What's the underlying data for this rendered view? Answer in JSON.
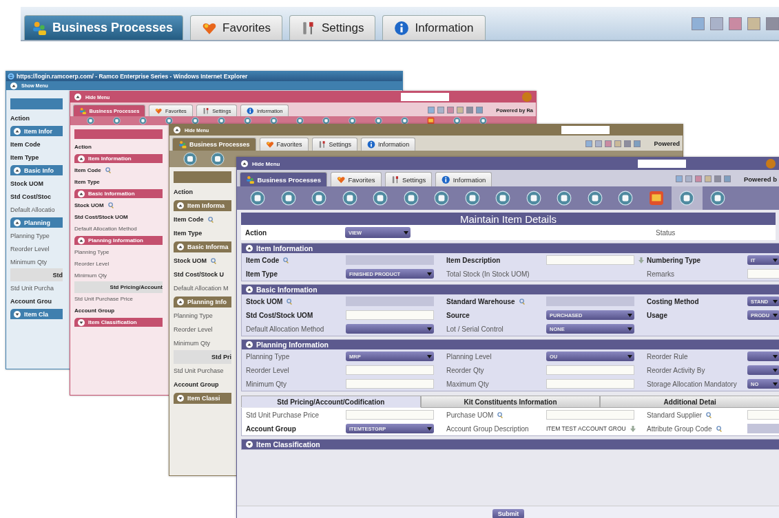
{
  "top_bar": {
    "tabs": [
      {
        "label": "Business Processes",
        "kind": "people",
        "selected": true
      },
      {
        "label": "Favorites",
        "kind": "heart",
        "selected": false
      },
      {
        "label": "Settings",
        "kind": "tools",
        "selected": false
      },
      {
        "label": "Information",
        "kind": "info",
        "selected": false
      }
    ],
    "swatches": [
      {
        "color": "#8fb0d6"
      },
      {
        "color": "#a9b2c9"
      },
      {
        "color": "#c98aa2"
      },
      {
        "color": "#c9b998"
      },
      {
        "color": "#8e8e9e"
      }
    ]
  },
  "windows": [
    {
      "color": "#3f7fae",
      "title": "https://login.ramcoerp.com/ - Ramco Enterprise Series - Windows Internet Explorer",
      "menu_toggle": "Show Menu",
      "strip": [
        {
          "kind": "band"
        },
        {
          "kind": "field",
          "text": "Action",
          "emphasis": true,
          "lookup": false
        },
        {
          "kind": "section",
          "text": "Item Infor",
          "expanded": true
        },
        {
          "kind": "field",
          "text": "Item Code",
          "emphasis": true,
          "lookup": false
        },
        {
          "kind": "field",
          "text": "Item Type",
          "emphasis": true,
          "lookup": false
        },
        {
          "kind": "section",
          "text": "Basic Info",
          "expanded": true
        },
        {
          "kind": "field",
          "text": "Stock UOM",
          "emphasis": true,
          "lookup": false
        },
        {
          "kind": "field",
          "text": "Std Cost/Stoc",
          "emphasis": true,
          "lookup": false
        },
        {
          "kind": "field",
          "text": "Default Allocatio",
          "emphasis": false,
          "lookup": false
        },
        {
          "kind": "section",
          "text": "Planning",
          "expanded": true
        },
        {
          "kind": "field",
          "text": "Planning Type",
          "emphasis": false,
          "lookup": false
        },
        {
          "kind": "field",
          "text": "Reorder Level",
          "emphasis": false,
          "lookup": false
        },
        {
          "kind": "field",
          "text": "Minimum Qty",
          "emphasis": false,
          "lookup": false
        },
        {
          "kind": "tab",
          "text": "Std"
        },
        {
          "kind": "field",
          "text": "Std Unit Purcha",
          "emphasis": false,
          "lookup": false
        },
        {
          "kind": "field",
          "text": "Account Grou",
          "emphasis": true,
          "lookup": false
        },
        {
          "kind": "section",
          "text": "Item Cla",
          "expanded": false
        }
      ]
    },
    {
      "color": "#c4506e",
      "menu_toggle": "Hide Menu",
      "search_field": true,
      "orb": true,
      "tabs": [
        {
          "label": "Business Processes",
          "kind": "people",
          "selected": true
        },
        {
          "label": "Favorites",
          "kind": "heart",
          "selected": false
        },
        {
          "label": "Settings",
          "kind": "tools",
          "selected": false
        },
        {
          "label": "Information",
          "kind": "info",
          "selected": false
        }
      ],
      "swatches": [
        {
          "color": "#8fb0d6"
        },
        {
          "color": "#a9b2c9"
        },
        {
          "color": "#c98aa2"
        },
        {
          "color": "#c9b998"
        },
        {
          "color": "#8e8e9e"
        },
        {
          "color": "#7f9fbf"
        }
      ],
      "powered": "Powered by Ra",
      "toolbar": [
        {
          "kind": "round",
          "selected": false
        },
        {
          "kind": "round",
          "selected": false
        },
        {
          "kind": "round",
          "selected": false
        },
        {
          "kind": "round",
          "selected": false
        },
        {
          "kind": "round",
          "selected": false
        },
        {
          "kind": "round",
          "selected": false
        },
        {
          "kind": "round",
          "selected": false
        },
        {
          "kind": "round",
          "selected": false
        },
        {
          "kind": "round",
          "selected": false
        },
        {
          "kind": "round",
          "selected": false
        },
        {
          "kind": "round",
          "selected": false
        },
        {
          "kind": "round",
          "selected": false
        },
        {
          "kind": "round",
          "selected": false
        },
        {
          "kind": "square",
          "selected": false
        },
        {
          "kind": "round",
          "selected": false
        },
        {
          "kind": "round",
          "selected": false
        }
      ],
      "strip": [
        {
          "kind": "band"
        },
        {
          "kind": "field",
          "text": "Action",
          "emphasis": true,
          "lookup": false
        },
        {
          "kind": "section",
          "text": "Item Information",
          "expanded": true
        },
        {
          "kind": "field",
          "text": "Item Code",
          "emphasis": true,
          "lookup": true
        },
        {
          "kind": "field",
          "text": "Item Type",
          "emphasis": true,
          "lookup": false
        },
        {
          "kind": "section",
          "text": "Basic Information",
          "expanded": true
        },
        {
          "kind": "field",
          "text": "Stock UOM",
          "emphasis": true,
          "lookup": true
        },
        {
          "kind": "field",
          "text": "Std Cost/Stock UOM",
          "emphasis": true,
          "lookup": false
        },
        {
          "kind": "field",
          "text": "Default Allocation Method",
          "emphasis": false,
          "lookup": false
        },
        {
          "kind": "section",
          "text": "Planning Information",
          "expanded": true
        },
        {
          "kind": "field",
          "text": "Planning Type",
          "emphasis": false,
          "lookup": false
        },
        {
          "kind": "field",
          "text": "Reorder Level",
          "emphasis": false,
          "lookup": false
        },
        {
          "kind": "field",
          "text": "Minimum Qty",
          "emphasis": false,
          "lookup": false
        },
        {
          "kind": "tab",
          "text": "Std Pricing/Account"
        },
        {
          "kind": "field",
          "text": "Std Unit Purchase Price",
          "emphasis": false,
          "lookup": false
        },
        {
          "kind": "field",
          "text": "Account Group",
          "emphasis": true,
          "lookup": false
        },
        {
          "kind": "section",
          "text": "Item Classification",
          "expanded": false
        }
      ]
    },
    {
      "color": "#857552",
      "menu_toggle": "Hide Menu",
      "search_field": true,
      "orb": false,
      "tabs": [
        {
          "label": "Business Processes",
          "kind": "people",
          "selected": true
        },
        {
          "label": "Favorites",
          "kind": "heart",
          "selected": false
        },
        {
          "label": "Settings",
          "kind": "tools",
          "selected": false
        },
        {
          "label": "Information",
          "kind": "info",
          "selected": false
        }
      ],
      "swatches": [
        {
          "color": "#8fb0d6"
        },
        {
          "color": "#a9b2c9"
        },
        {
          "color": "#c98aa2"
        },
        {
          "color": "#c9b998"
        },
        {
          "color": "#8e8e9e"
        },
        {
          "color": "#7f9fbf"
        }
      ],
      "powered": "Powered",
      "toolbar": [
        {
          "kind": "round",
          "selected": false
        },
        {
          "kind": "round",
          "selected": false
        }
      ],
      "strip": [
        {
          "kind": "band"
        },
        {
          "kind": "field",
          "text": "Action",
          "emphasis": true,
          "lookup": false
        },
        {
          "kind": "section",
          "text": "Item Informa",
          "expanded": true
        },
        {
          "kind": "field",
          "text": "Item Code",
          "emphasis": true,
          "lookup": true
        },
        {
          "kind": "field",
          "text": "Item Type",
          "emphasis": true,
          "lookup": false
        },
        {
          "kind": "section",
          "text": "Basic Informa",
          "expanded": true
        },
        {
          "kind": "field",
          "text": "Stock UOM",
          "emphasis": true,
          "lookup": true
        },
        {
          "kind": "field",
          "text": "Std Cost/Stock U",
          "emphasis": true,
          "lookup": false
        },
        {
          "kind": "field",
          "text": "Default Allocation M",
          "emphasis": false,
          "lookup": false
        },
        {
          "kind": "section",
          "text": "Planning Info",
          "expanded": true
        },
        {
          "kind": "field",
          "text": "Planning Type",
          "emphasis": false,
          "lookup": false
        },
        {
          "kind": "field",
          "text": "Reorder Level",
          "emphasis": false,
          "lookup": false
        },
        {
          "kind": "field",
          "text": "Minimum Qty",
          "emphasis": false,
          "lookup": false
        },
        {
          "kind": "tab",
          "text": "Std Pri"
        },
        {
          "kind": "field",
          "text": "Std Unit Purchase",
          "emphasis": false,
          "lookup": false
        },
        {
          "kind": "field",
          "text": "Account Group",
          "emphasis": true,
          "lookup": false
        },
        {
          "kind": "section",
          "text": "Item Classi",
          "expanded": false
        }
      ]
    },
    {
      "color": "#5c5a8e",
      "menu_toggle": "Hide Menu",
      "search_field": true,
      "orb": true,
      "tabs": [
        {
          "label": "Business Processes",
          "kind": "people",
          "selected": true
        },
        {
          "label": "Favorites",
          "kind": "heart",
          "selected": false
        },
        {
          "label": "Settings",
          "kind": "tools",
          "selected": false
        },
        {
          "label": "Information",
          "kind": "info",
          "selected": false
        }
      ],
      "swatches": [
        {
          "color": "#8fb0d6"
        },
        {
          "color": "#a9b2c9"
        },
        {
          "color": "#c98aa2"
        },
        {
          "color": "#c9b998"
        },
        {
          "color": "#8e8e9e"
        },
        {
          "color": "#7f9fbf"
        }
      ],
      "powered": "Powered b",
      "toolbar": [
        {
          "kind": "round",
          "selected": false
        },
        {
          "kind": "round",
          "selected": false
        },
        {
          "kind": "round",
          "selected": false
        },
        {
          "kind": "round",
          "selected": false
        },
        {
          "kind": "round",
          "selected": false
        },
        {
          "kind": "round",
          "selected": false
        },
        {
          "kind": "round",
          "selected": false
        },
        {
          "kind": "round",
          "selected": false
        },
        {
          "kind": "round",
          "selected": false
        },
        {
          "kind": "round",
          "selected": false
        },
        {
          "kind": "round",
          "selected": false
        },
        {
          "kind": "round",
          "selected": false
        },
        {
          "kind": "round",
          "selected": false
        },
        {
          "kind": "square",
          "selected": false
        },
        {
          "kind": "round",
          "selected": true
        },
        {
          "kind": "round",
          "selected": false
        }
      ],
      "form": {
        "title": "Maintain Item Details",
        "action_label": "Action",
        "action_value": "VIEW",
        "status_label": "Status",
        "sections": [
          {
            "title": "Item Information",
            "expanded": true,
            "rows": [
              [
                {
                  "label": "Item Code",
                  "emphasis": true,
                  "lookup": true,
                  "control": {
                    "kind": "readonly"
                  }
                },
                {
                  "label": "Item Description",
                  "emphasis": true,
                  "lookup": false,
                  "control": {
                    "kind": "input",
                    "trailing_icon": true
                  }
                },
                {
                  "label": "Numbering Type",
                  "emphasis": true,
                  "lookup": false,
                  "control": {
                    "kind": "select",
                    "value": "IT"
                  }
                }
              ],
              [
                {
                  "label": "Item Type",
                  "emphasis": true,
                  "lookup": false,
                  "control": {
                    "kind": "select",
                    "value": "FINISHED PRODUCT"
                  }
                },
                {
                  "label": "Total Stock (In Stock UOM)",
                  "emphasis": false,
                  "lookup": false
                },
                {
                  "label": "Remarks",
                  "emphasis": false,
                  "lookup": false,
                  "control": {
                    "kind": "input"
                  }
                }
              ]
            ]
          },
          {
            "title": "Basic Information",
            "expanded": true,
            "rows": [
              [
                {
                  "label": "Stock UOM",
                  "emphasis": true,
                  "lookup": true,
                  "control": {
                    "kind": "readonly"
                  }
                },
                {
                  "label": "Standard Warehouse",
                  "emphasis": true,
                  "lookup": true,
                  "control": {
                    "kind": "readonly"
                  }
                },
                {
                  "label": "Costing Method",
                  "emphasis": true,
                  "lookup": false,
                  "control": {
                    "kind": "select",
                    "value": "STAND"
                  }
                }
              ],
              [
                {
                  "label": "Std Cost/Stock UOM",
                  "emphasis": true,
                  "lookup": false,
                  "control": {
                    "kind": "input"
                  }
                },
                {
                  "label": "Source",
                  "emphasis": true,
                  "lookup": false,
                  "control": {
                    "kind": "select",
                    "value": "PURCHASED"
                  }
                },
                {
                  "label": "Usage",
                  "emphasis": true,
                  "lookup": false,
                  "control": {
                    "kind": "select",
                    "value": "PRODU"
                  }
                }
              ],
              [
                {
                  "label": "Default Allocation Method",
                  "emphasis": false,
                  "lookup": false,
                  "control": {
                    "kind": "select"
                  }
                },
                {
                  "label": "Lot / Serial Control",
                  "emphasis": false,
                  "lookup": false,
                  "control": {
                    "kind": "select",
                    "value": "NONE"
                  }
                }
              ]
            ]
          },
          {
            "title": "Planning Information",
            "expanded": true,
            "rows": [
              [
                {
                  "label": "Planning Type",
                  "emphasis": false,
                  "lookup": false,
                  "control": {
                    "kind": "select",
                    "value": "MRP"
                  }
                },
                {
                  "label": "Planning Level",
                  "emphasis": false,
                  "lookup": false,
                  "control": {
                    "kind": "select",
                    "value": "OU"
                  }
                },
                {
                  "label": "Reorder Rule",
                  "emphasis": false,
                  "lookup": false,
                  "control": {
                    "kind": "select"
                  }
                }
              ],
              [
                {
                  "label": "Reorder Level",
                  "emphasis": false,
                  "lookup": false,
                  "control": {
                    "kind": "input"
                  }
                },
                {
                  "label": "Reorder Qty",
                  "emphasis": false,
                  "lookup": false,
                  "control": {
                    "kind": "input"
                  }
                },
                {
                  "label": "Reorder Activity By",
                  "emphasis": false,
                  "lookup": false,
                  "control": {
                    "kind": "select"
                  }
                }
              ],
              [
                {
                  "label": "Minimum Qty",
                  "emphasis": false,
                  "lookup": false,
                  "control": {
                    "kind": "input"
                  }
                },
                {
                  "label": "Maximum Qty",
                  "emphasis": false,
                  "lookup": false,
                  "control": {
                    "kind": "input"
                  }
                },
                {
                  "label": "Storage Allocation Mandatory",
                  "emphasis": false,
                  "lookup": false,
                  "control": {
                    "kind": "select",
                    "value": "NO"
                  }
                }
              ]
            ]
          }
        ],
        "tabs": [
          {
            "label": "Std Pricing/Account/Codification",
            "selected": true
          },
          {
            "label": "Kit Constituents Information",
            "selected": false
          },
          {
            "label": "Additional Detai",
            "selected": false
          }
        ],
        "tab_rows": [
          [
            {
              "label": "Std Unit Purchase Price",
              "emphasis": false,
              "lookup": false,
              "control": {
                "kind": "input"
              }
            },
            {
              "label": "Purchase UOM",
              "emphasis": false,
              "lookup": true,
              "control": {
                "kind": "input"
              }
            },
            {
              "label": "Standard Supplier",
              "emphasis": false,
              "lookup": true,
              "control": {
                "kind": "input"
              }
            }
          ],
          [
            {
              "label": "Account Group",
              "emphasis": true,
              "lookup": false,
              "control": {
                "kind": "select",
                "value": "ITEMTESTGRP"
              }
            },
            {
              "label": "Account Group Description",
              "emphasis": false,
              "lookup": false,
              "control": {
                "kind": "note",
                "value": "ITEM TEST ACCOUNT GROU",
                "trailing_icon": true
              }
            },
            {
              "label": "Attribute Group Code",
              "emphasis": false,
              "lookup": true,
              "control": {
                "kind": "readonly"
              }
            }
          ]
        ],
        "closed_sections": [
          {
            "title": "Item Classification",
            "expanded": false
          }
        ],
        "submit": "Submit"
      }
    }
  ]
}
